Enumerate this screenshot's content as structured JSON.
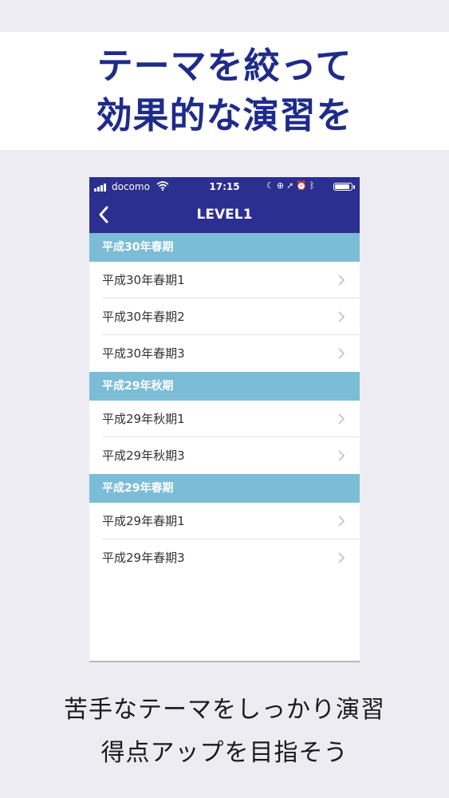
{
  "headline": {
    "line1": "テーマを絞って",
    "line2": "効果的な演習を"
  },
  "status_bar": {
    "carrier": "docomo",
    "time": "17:15",
    "icons": [
      "signal-icon",
      "wifi-icon",
      "moon-icon",
      "lock-rotation-icon",
      "location-icon",
      "alarm-icon",
      "bluetooth-icon",
      "battery-icon"
    ],
    "battery_level": 0.9
  },
  "nav": {
    "title": "LEVEL1",
    "back_icon": "chevron-left-icon"
  },
  "sections": [
    {
      "header": "平成30年春期",
      "items": [
        {
          "label": "平成30年春期1"
        },
        {
          "label": "平成30年春期2"
        },
        {
          "label": "平成30年春期3"
        }
      ]
    },
    {
      "header": "平成29年秋期",
      "items": [
        {
          "label": "平成29年秋期1"
        },
        {
          "label": "平成29年秋期3"
        }
      ]
    },
    {
      "header": "平成29年春期",
      "items": [
        {
          "label": "平成29年春期1"
        },
        {
          "label": "平成29年春期3"
        }
      ]
    }
  ],
  "footer": {
    "line1": "苦手なテーマをしっかり演習",
    "line2": "得点アップを目指そう"
  },
  "colors": {
    "accent": "#2b2f8f",
    "headline": "#1f2b8a",
    "section_header": "#7bbcd6",
    "background": "#ececf2"
  }
}
